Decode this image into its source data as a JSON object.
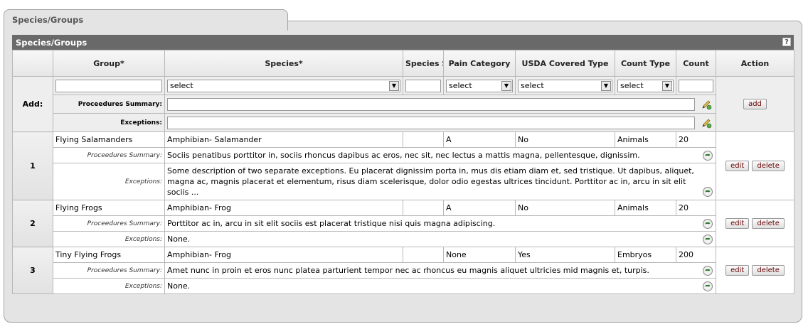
{
  "tab": {
    "label": "Species/Groups"
  },
  "section": {
    "title": "Species/Groups",
    "help": "?"
  },
  "columns": {
    "group": "Group*",
    "species": "Species*",
    "strain": "Species Strain",
    "pain": "Pain Category",
    "usda": "USDA Covered Type",
    "count_type": "Count Type",
    "count": "Count",
    "action": "Action"
  },
  "add_row": {
    "label": "Add:",
    "species_select": "select",
    "pain_select": "select",
    "usda_select": "select",
    "count_type_select": "select",
    "proc_label": "Proceedures Summary:",
    "exc_label": "Exceptions:",
    "add_button": "add"
  },
  "sub_labels": {
    "proc": "Proceedures Summary:",
    "exc": "Exceptions:"
  },
  "rows": [
    {
      "num": "1",
      "group": "Flying Salamanders",
      "species": "Amphibian- Salamander",
      "strain": "",
      "pain": "A",
      "usda": "No",
      "count_type": "Animals",
      "count": "20",
      "proc": "Sociis penatibus porttitor in, sociis rhoncus dapibus ac eros, nec sit, nec lectus a mattis magna, pellentesque, dignissim.",
      "exc": "Some description of two separate exceptions. Eu placerat dignissim porta in, mus dis etiam diam et, sed tristique. Ut dapibus, aliquet, magna ac, magnis placerat et elementum, risus diam scelerisque, dolor odio egestas ultrices tincidunt. Porttitor ac in, arcu in sit elit sociis ...",
      "edit": "edit",
      "delete": "delete"
    },
    {
      "num": "2",
      "group": "Flying Frogs",
      "species": "Amphibian- Frog",
      "strain": "",
      "pain": "A",
      "usda": "No",
      "count_type": "Animals",
      "count": "20",
      "proc": "Porttitor ac in, arcu in sit elit sociis est placerat tristique nisi quis magna adipiscing.",
      "exc": "None.",
      "edit": "edit",
      "delete": "delete"
    },
    {
      "num": "3",
      "group": "Tiny Flying Frogs",
      "species": "Amphibian- Frog",
      "strain": "",
      "pain": "None",
      "usda": "Yes",
      "count_type": "Embryos",
      "count": "200",
      "proc": "Amet nunc in proin et eros nunc platea parturient tempor nec ac rhoncus eu magnis aliquet ultricies mid magnis et, turpis.",
      "exc": "None.",
      "edit": "edit",
      "delete": "delete"
    }
  ],
  "icons": {
    "pencil": "pencil-icon",
    "go": "go-arrow-icon"
  }
}
